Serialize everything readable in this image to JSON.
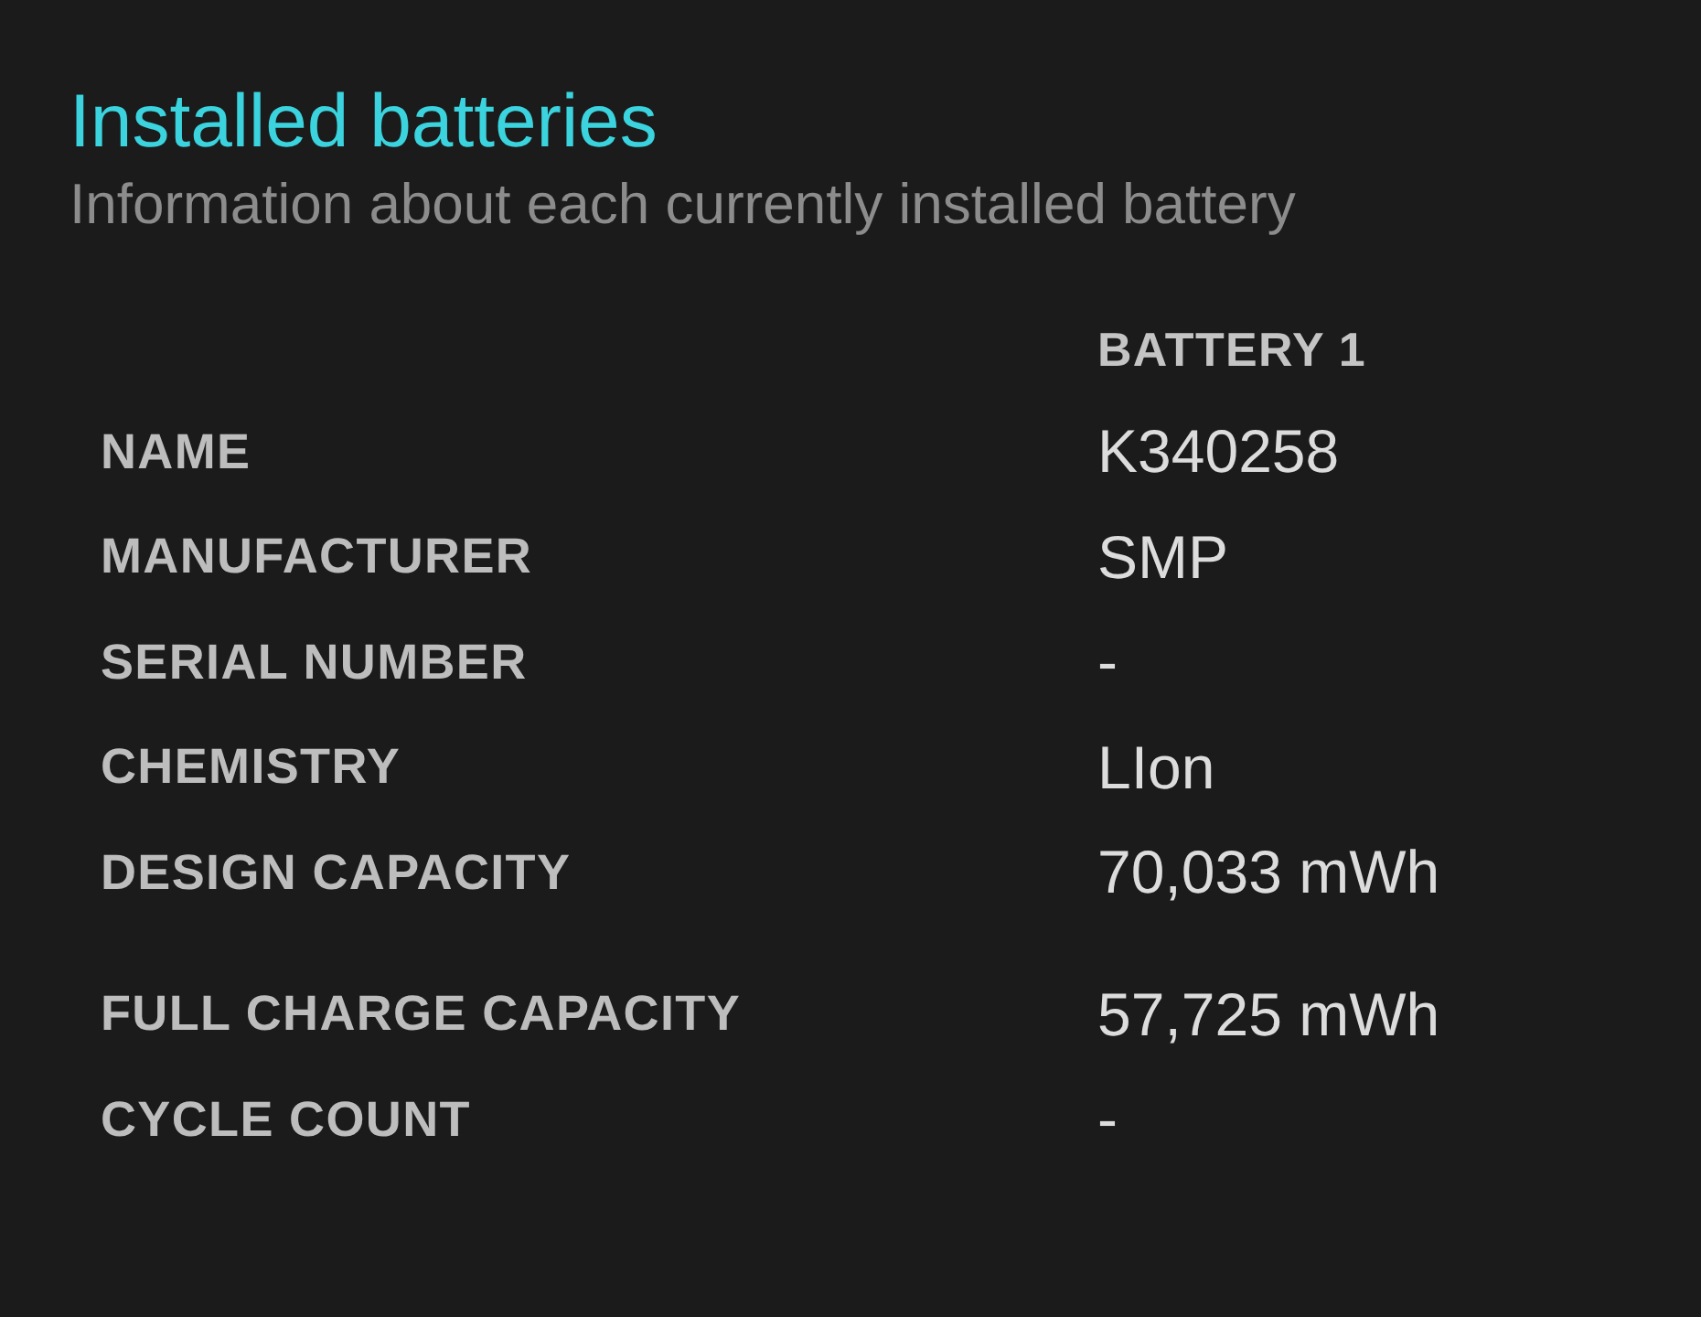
{
  "title": "Installed batteries",
  "subtitle": "Information about each currently installed battery",
  "table": {
    "columns": [
      "BATTERY 1"
    ],
    "sections": [
      [
        {
          "label": "NAME",
          "value": "K340258"
        },
        {
          "label": "MANUFACTURER",
          "value": "SMP"
        },
        {
          "label": "SERIAL NUMBER",
          "value": "-"
        },
        {
          "label": "CHEMISTRY",
          "value": "LIon"
        },
        {
          "label": "DESIGN CAPACITY",
          "value": "70,033 mWh"
        }
      ],
      [
        {
          "label": "FULL CHARGE CAPACITY",
          "value": "57,725 mWh"
        },
        {
          "label": "CYCLE COUNT",
          "value": "-"
        }
      ]
    ]
  }
}
